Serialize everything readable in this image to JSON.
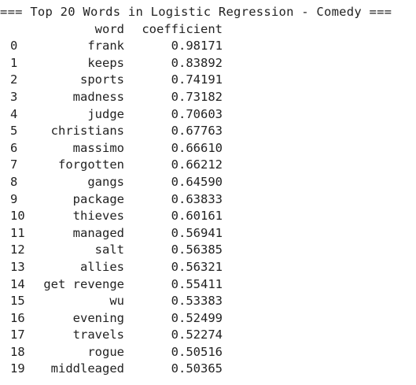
{
  "title": "=== Top 20 Words in Logistic Regression - Comedy ===",
  "header": {
    "word": "word",
    "coefficient": "coefficient"
  },
  "rows": [
    {
      "index": "0",
      "word": "frank",
      "coefficient": "0.98171"
    },
    {
      "index": "1",
      "word": "keeps",
      "coefficient": "0.83892"
    },
    {
      "index": "2",
      "word": "sports",
      "coefficient": "0.74191"
    },
    {
      "index": "3",
      "word": "madness",
      "coefficient": "0.73182"
    },
    {
      "index": "4",
      "word": "judge",
      "coefficient": "0.70603"
    },
    {
      "index": "5",
      "word": "christians",
      "coefficient": "0.67763"
    },
    {
      "index": "6",
      "word": "massimo",
      "coefficient": "0.66610"
    },
    {
      "index": "7",
      "word": "forgotten",
      "coefficient": "0.66212"
    },
    {
      "index": "8",
      "word": "gangs",
      "coefficient": "0.64590"
    },
    {
      "index": "9",
      "word": "package",
      "coefficient": "0.63833"
    },
    {
      "index": "10",
      "word": "thieves",
      "coefficient": "0.60161"
    },
    {
      "index": "11",
      "word": "managed",
      "coefficient": "0.56941"
    },
    {
      "index": "12",
      "word": "salt",
      "coefficient": "0.56385"
    },
    {
      "index": "13",
      "word": "allies",
      "coefficient": "0.56321"
    },
    {
      "index": "14",
      "word": "get revenge",
      "coefficient": "0.55411"
    },
    {
      "index": "15",
      "word": "wu",
      "coefficient": "0.53383"
    },
    {
      "index": "16",
      "word": "evening",
      "coefficient": "0.52499"
    },
    {
      "index": "17",
      "word": "travels",
      "coefficient": "0.52274"
    },
    {
      "index": "18",
      "word": "rogue",
      "coefficient": "0.50516"
    },
    {
      "index": "19",
      "word": "middleaged",
      "coefficient": "0.50365"
    }
  ]
}
